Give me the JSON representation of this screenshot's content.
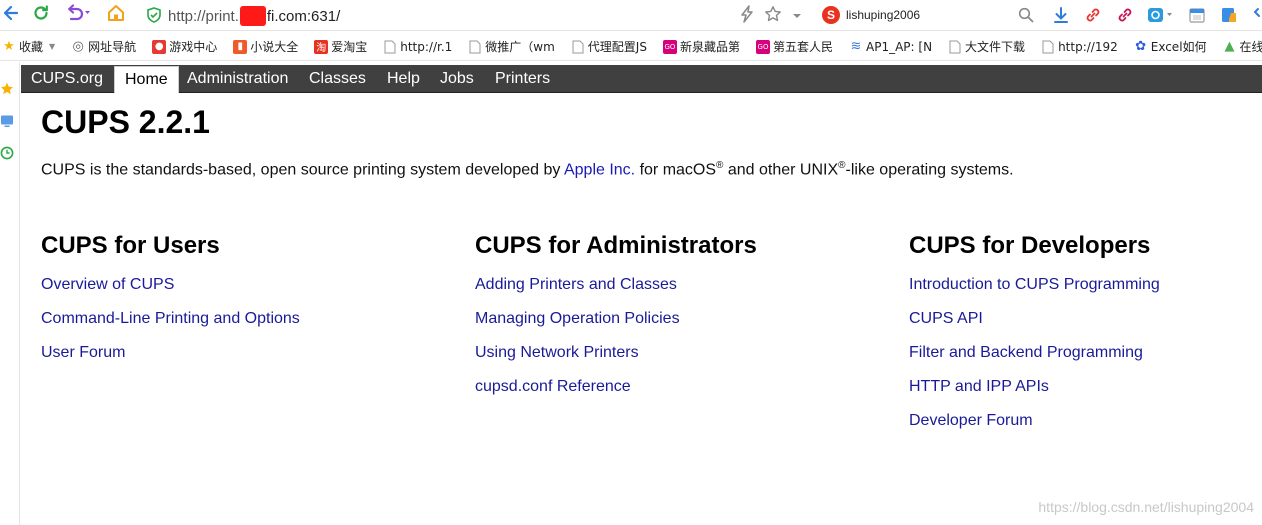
{
  "browser": {
    "url": {
      "scheme_host_prefix": "http://print.",
      "host_suffix": "fi.com:631/"
    },
    "search": {
      "query": "lishuping2006"
    },
    "bookmarks": [
      {
        "label": "收藏",
        "icon": "star-icon",
        "color": "#f5b400"
      },
      {
        "label": "网址导航",
        "icon": "globe-icon",
        "color": "#666666"
      },
      {
        "label": "游戏中心",
        "icon": "game-icon",
        "color": "#e53935"
      },
      {
        "label": "小说大全",
        "icon": "book-icon",
        "color": "#f05a2a"
      },
      {
        "label": "爱淘宝",
        "icon": "taobao-icon",
        "color": "#e8321f"
      },
      {
        "label": "http://r.1",
        "icon": "page-icon",
        "color": "#999999"
      },
      {
        "label": "微推广（wm",
        "icon": "page-icon",
        "color": "#999999"
      },
      {
        "label": "代理配置JS",
        "icon": "page-icon",
        "color": "#999999"
      },
      {
        "label": "新泉藏品第",
        "icon": "gome-icon",
        "color": "#d6007a"
      },
      {
        "label": "第五套人民",
        "icon": "gome-icon",
        "color": "#d6007a"
      },
      {
        "label": "AP1_AP: [N",
        "icon": "rss-icon",
        "color": "#3a7bd5"
      },
      {
        "label": "大文件下载",
        "icon": "page-icon",
        "color": "#999999"
      },
      {
        "label": "http://192",
        "icon": "page-icon",
        "color": "#999999"
      },
      {
        "label": "Excel如何",
        "icon": "baidu-icon",
        "color": "#2b5ae0"
      },
      {
        "label": "在线",
        "icon": "site-icon",
        "color": "#4caf50"
      }
    ]
  },
  "cups": {
    "nav": [
      {
        "label": "CUPS.org",
        "active": false
      },
      {
        "label": "Home",
        "active": true
      },
      {
        "label": "Administration",
        "active": false
      },
      {
        "label": "Classes",
        "active": false
      },
      {
        "label": "Help",
        "active": false
      },
      {
        "label": "Jobs",
        "active": false
      },
      {
        "label": "Printers",
        "active": false
      }
    ],
    "title": "CUPS 2.2.1",
    "intro": {
      "part1": "CUPS is the standards-based, open source printing system developed by ",
      "link": "Apple Inc.",
      "part2": " for macOS",
      "reg": "®",
      "part3": " and other UNIX",
      "part4": "-like operating systems."
    },
    "columns": [
      {
        "heading": "CUPS for Users",
        "links": [
          "Overview of CUPS",
          "Command-Line Printing and Options",
          "User Forum"
        ]
      },
      {
        "heading": "CUPS for Administrators",
        "links": [
          "Adding Printers and Classes",
          "Managing Operation Policies",
          "Using Network Printers",
          "cupsd.conf Reference"
        ]
      },
      {
        "heading": "CUPS for Developers",
        "links": [
          "Introduction to CUPS Programming",
          "CUPS API",
          "Filter and Backend Programming",
          "HTTP and IPP APIs",
          "Developer Forum"
        ]
      }
    ]
  },
  "watermark": "https://blog.csdn.net/lishuping2004"
}
